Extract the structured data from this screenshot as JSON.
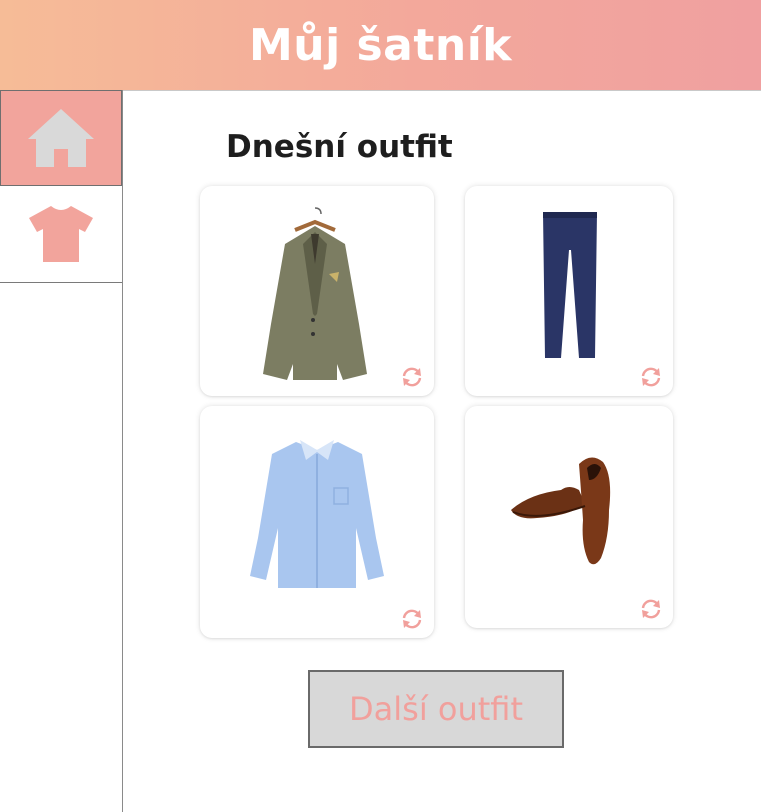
{
  "header": {
    "title": "Můj šatník"
  },
  "sidebar": {
    "items": [
      {
        "icon": "home-icon",
        "active": true
      },
      {
        "icon": "tshirt-icon",
        "active": false
      }
    ]
  },
  "outfit": {
    "title": "Dnešní outfit",
    "items": [
      {
        "icon": "blazer-icon"
      },
      {
        "icon": "trousers-icon"
      },
      {
        "icon": "shirt-icon"
      },
      {
        "icon": "shoes-icon"
      }
    ],
    "next_label": "Další outfit"
  },
  "colors": {
    "header_start": "#f6bc97",
    "header_end": "#f0a0a0",
    "accent": "#f2a49c",
    "icon_gray": "#d9d9d9"
  }
}
